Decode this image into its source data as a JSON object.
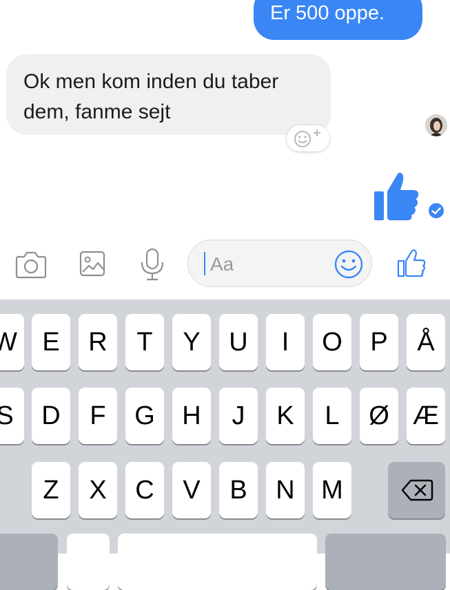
{
  "messages": {
    "outgoing_text": "Er 500 oppe.",
    "incoming_text": "Ok men kom inden du taber dem, fanme sejt"
  },
  "composer": {
    "placeholder": "Aa"
  },
  "keyboard": {
    "row1": [
      "W",
      "E",
      "R",
      "T",
      "Y",
      "U",
      "I",
      "O",
      "P",
      "Å"
    ],
    "row2": [
      "S",
      "D",
      "F",
      "G",
      "H",
      "J",
      "K",
      "L",
      "Ø",
      "Æ"
    ],
    "row3": [
      "Z",
      "X",
      "C",
      "V",
      "B",
      "N",
      "M"
    ]
  },
  "colors": {
    "accent": "#3a86f5",
    "incoming_bubble": "#f1f0f0",
    "keyboard_bg": "#d1d4d9",
    "icon_gray": "#8e8e93"
  },
  "icons": [
    "camera-icon",
    "image-icon",
    "microphone-icon",
    "emoji-icon",
    "like-icon",
    "add-reaction-icon",
    "read-receipt-icon",
    "backspace-icon"
  ]
}
